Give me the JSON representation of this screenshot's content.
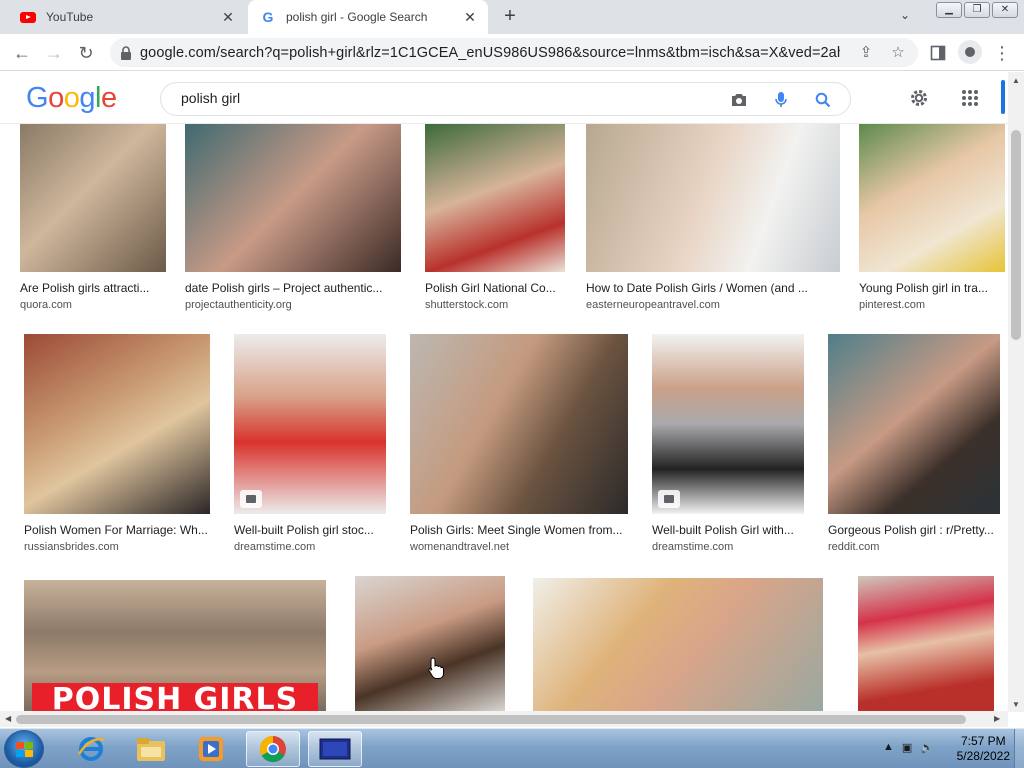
{
  "browser": {
    "tabs": [
      {
        "title": "YouTube",
        "favicon": "youtube-icon"
      },
      {
        "title": "polish girl - Google Search",
        "favicon": "google-icon"
      }
    ],
    "url": "google.com/search?q=polish+girl&rlz=1C1GCEA_enUS986US986&source=lnms&tbm=isch&sa=X&ved=2ahUK..."
  },
  "google": {
    "logo_letters": [
      "G",
      "o",
      "o",
      "g",
      "l",
      "e"
    ],
    "logo_colors": [
      "#4285f4",
      "#ea4335",
      "#fbbc05",
      "#4285f4",
      "#34a853",
      "#ea4335"
    ],
    "query": "polish girl"
  },
  "results": [
    {
      "caption": "Are Polish girls attracti...",
      "source": "quora.com"
    },
    {
      "caption": "date Polish girls – Project authentic...",
      "source": "projectauthenticity.org"
    },
    {
      "caption": "Polish Girl National Co...",
      "source": "shutterstock.com"
    },
    {
      "caption": "How to Date Polish Girls / Women (and ...",
      "source": "easterneuropeantravel.com"
    },
    {
      "caption": "Young Polish girl in tra...",
      "source": "pinterest.com"
    },
    {
      "caption": "Polish Women For Marriage: Wh...",
      "source": "russiansbrides.com"
    },
    {
      "caption": "Well-built Polish girl stoc...",
      "source": "dreamstime.com"
    },
    {
      "caption": "Polish Girls: Meet Single Women from...",
      "source": "womenandtravel.net"
    },
    {
      "caption": "Well-built Polish Girl with...",
      "source": "dreamstime.com"
    },
    {
      "caption": "Gorgeous Polish girl : r/Pretty...",
      "source": "reddit.com"
    },
    {
      "banner": "POLISH GIRLS"
    },
    {},
    {},
    {}
  ],
  "taskbar": {
    "time": "7:57 PM",
    "date": "5/28/2022",
    "apps": [
      "internet-explorer",
      "file-explorer",
      "media-player",
      "chrome",
      "remote-desktop"
    ]
  }
}
